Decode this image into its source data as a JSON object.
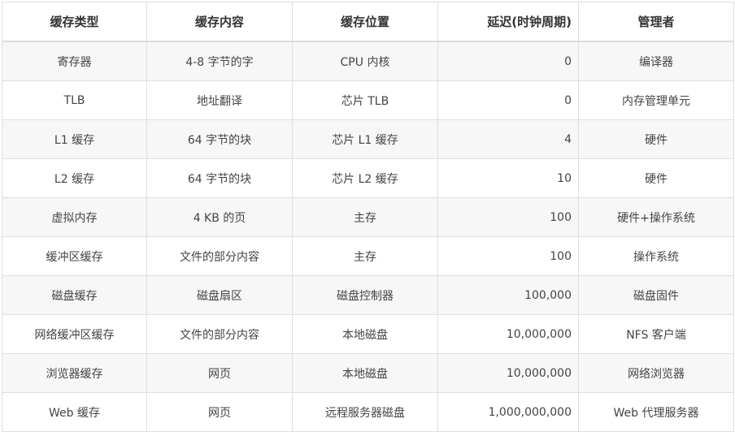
{
  "table": {
    "headers": [
      "缓存类型",
      "缓存内容",
      "缓存位置",
      "延迟(时钟周期)",
      "管理者"
    ],
    "rows": [
      [
        "寄存器",
        "4-8 字节的字",
        "CPU 内核",
        "0",
        "编译器"
      ],
      [
        "TLB",
        "地址翻译",
        "芯片 TLB",
        "0",
        "内存管理单元"
      ],
      [
        "L1 缓存",
        "64 字节的块",
        "芯片 L1 缓存",
        "4",
        "硬件"
      ],
      [
        "L2 缓存",
        "64 字节的块",
        "芯片 L2 缓存",
        "10",
        "硬件"
      ],
      [
        "虚拟内存",
        "4 KB 的页",
        "主存",
        "100",
        "硬件+操作系统"
      ],
      [
        "缓冲区缓存",
        "文件的部分内容",
        "主存",
        "100",
        "操作系统"
      ],
      [
        "磁盘缓存",
        "磁盘扇区",
        "磁盘控制器",
        "100,000",
        "磁盘固件"
      ],
      [
        "网络缓冲区缓存",
        "文件的部分内容",
        "本地磁盘",
        "10,000,000",
        "NFS 客户端"
      ],
      [
        "浏览器缓存",
        "网页",
        "本地磁盘",
        "10,000,000",
        "网络浏览器"
      ],
      [
        "Web 缓存",
        "网页",
        "远程服务器磁盘",
        "1,000,000,000",
        "Web 代理服务器"
      ]
    ]
  }
}
